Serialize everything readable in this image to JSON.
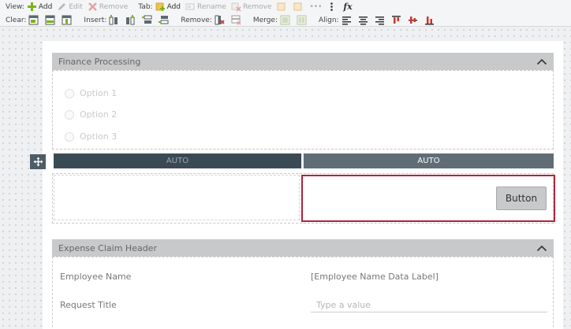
{
  "toolbar": {
    "view_label": "View:",
    "view_add": "Add",
    "view_edit": "Edit",
    "view_remove": "Remove",
    "tab_label": "Tab:",
    "tab_add": "Add",
    "tab_rename": "Rename",
    "tab_remove": "Remove",
    "more": "•••",
    "fx": "fx",
    "clear_label": "Clear:",
    "insert_label": "Insert:",
    "remove_label": "Remove:",
    "merge_label": "Merge:",
    "align_label": "Align:"
  },
  "sections": {
    "finance": {
      "title": "Finance Processing",
      "options": [
        "Option 1",
        "Option 2",
        "Option 3"
      ]
    },
    "expense": {
      "title": "Expense Claim Header"
    }
  },
  "columns": {
    "left_width": "AUTO",
    "right_width": "AUTO"
  },
  "button": {
    "label": "Button"
  },
  "fields": {
    "employee_name_label": "Employee Name",
    "employee_name_value": "[Employee Name Data Label]",
    "request_title_label": "Request Title",
    "request_title_placeholder": "Type a value"
  },
  "colors": {
    "selection_border": "#b0233c",
    "column_bar_dark": "#3a4a55",
    "column_bar_light": "#5f6d76",
    "section_header": "#c8c9cb"
  }
}
